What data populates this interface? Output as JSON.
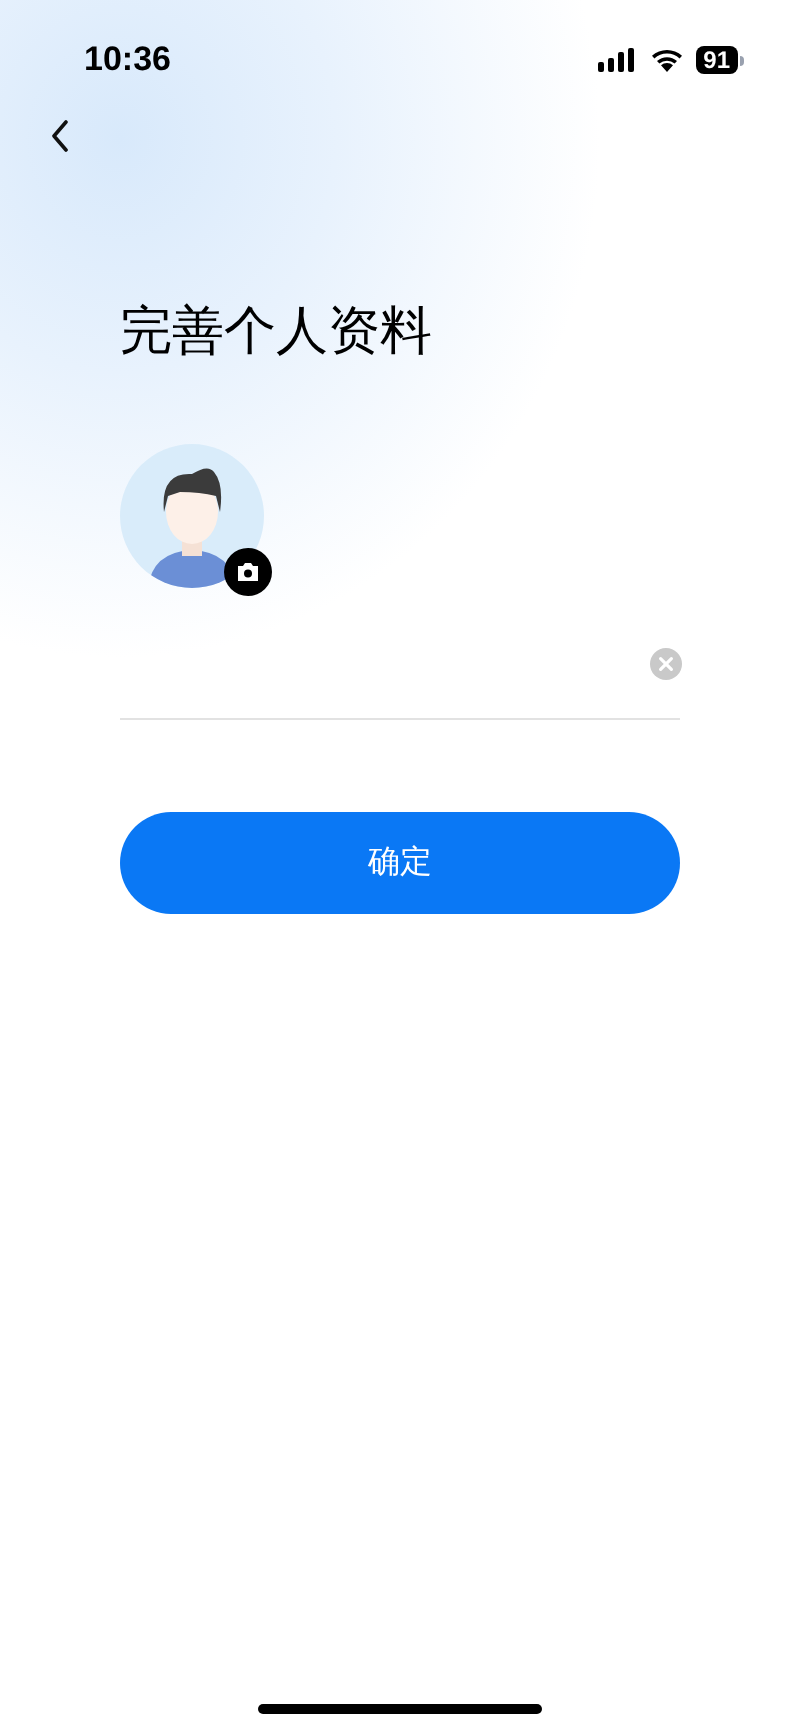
{
  "status_bar": {
    "time": "10:36",
    "battery": "91"
  },
  "title": "完善个人资料",
  "confirm_button": {
    "label": "确定"
  }
}
